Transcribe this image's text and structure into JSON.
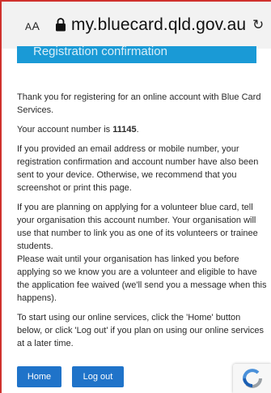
{
  "browser": {
    "text_size_small": "A",
    "text_size_large": "A",
    "url": "my.bluecard.qld.gov.au",
    "reload_glyph": "↻"
  },
  "banner": {
    "title": "Registration confirmation"
  },
  "main": {
    "intro": "Thank you for registering for an online account with Blue Card Services.",
    "account_prefix": "Your account number is ",
    "account_number": "11145",
    "account_suffix": ".",
    "email_note": "If you provided an email address or mobile number, your registration confirmation and account number have also been sent to your device. Otherwise, we recommend that you screenshot or print this page.",
    "volunteer_note": "If you are planning on applying for a volunteer blue card, tell your organisation this account number. Your organisation will use that number to link you as one of its volunteers or trainee students.",
    "wait_note": "Please wait until your organisation has linked you before applying so we know you are a volunteer and eligible to have the application fee waived (we'll send you a message when this happens).",
    "start_note": "To start using our online services, click the 'Home' button below, or click 'Log out' if you plan on using our online services at a later time."
  },
  "actions": {
    "home_label": "Home",
    "logout_label": "Log out"
  },
  "colors": {
    "brand_blue": "#1a9ad6",
    "button_blue": "#1f73c9",
    "frame_red": "#d0312d"
  },
  "icons": [
    "lock-icon",
    "reload-icon",
    "recaptcha-icon"
  ]
}
